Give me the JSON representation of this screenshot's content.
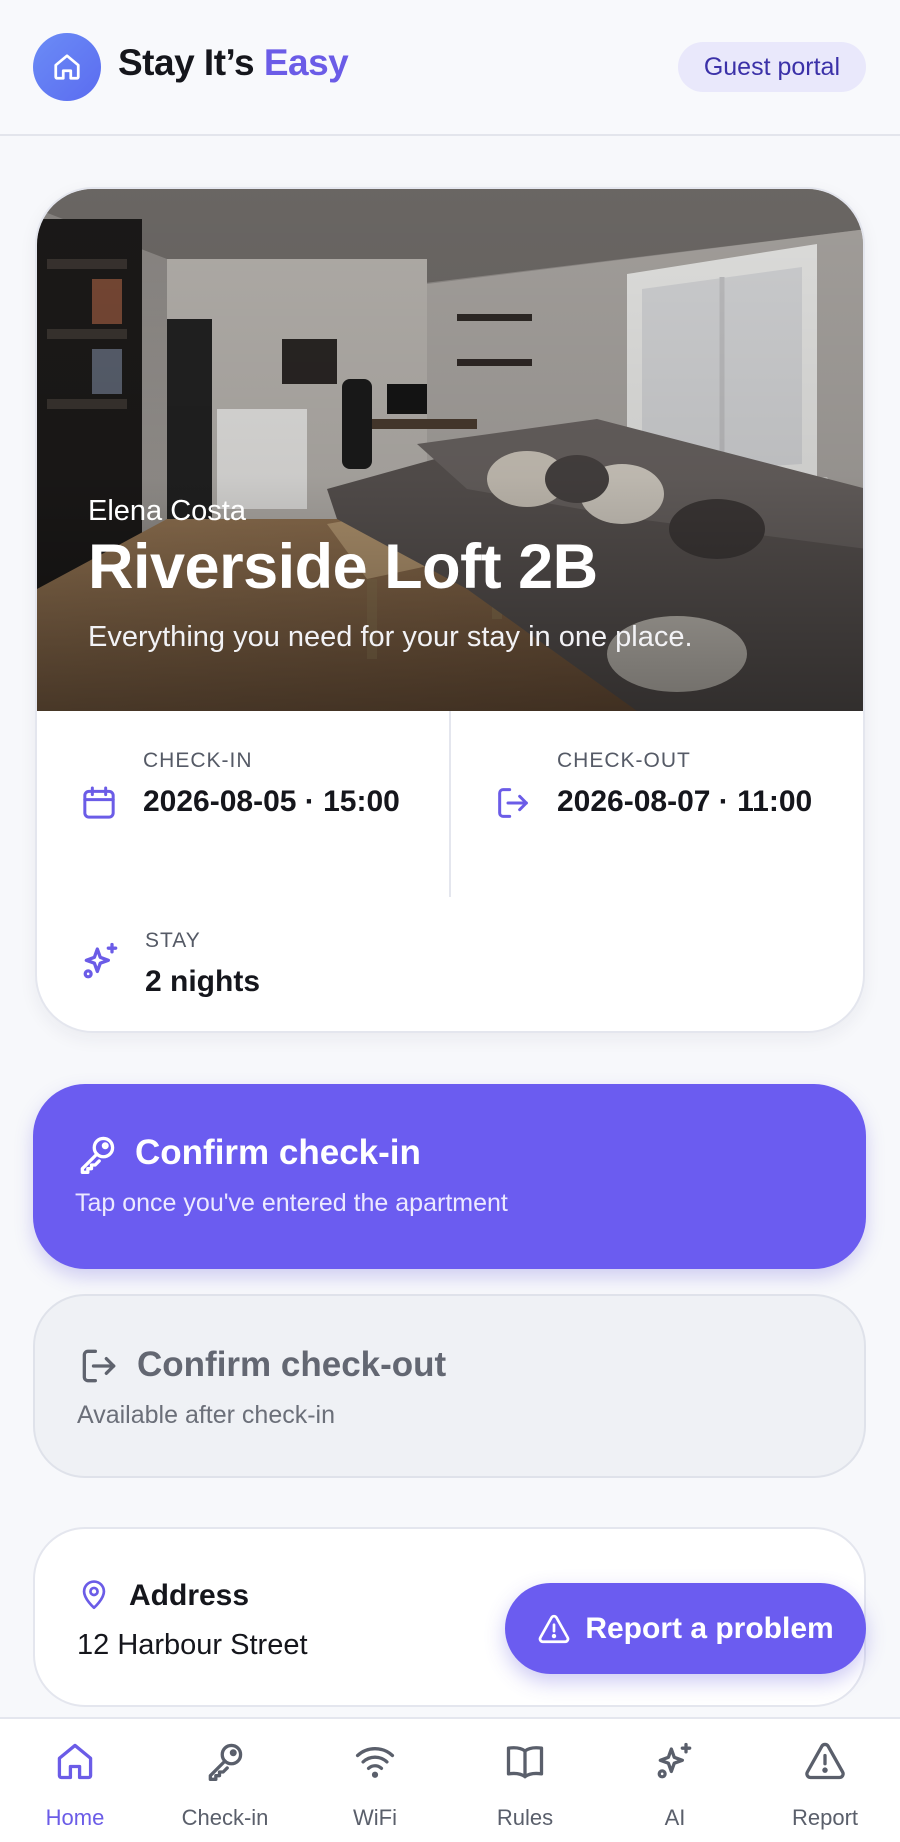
{
  "header": {
    "brand_prefix": "Stay It’s ",
    "brand_accent": "Easy",
    "portal_label": "Guest portal",
    "logo_icon": "home-icon"
  },
  "hero": {
    "guest_name": "Elena Costa",
    "apartment_name": "Riverside Loft 2B",
    "tagline": "Everything you need for your stay in one place.",
    "image": "living-room-photo"
  },
  "stay_info": {
    "checkin_label": "CHECK-IN",
    "checkin_value": "2026-08-05 · 15:00",
    "checkout_label": "CHECK-OUT",
    "checkout_value": "2026-08-07 · 11:00",
    "stay_label": "STAY",
    "stay_value": "2 nights"
  },
  "actions": {
    "checkin_title": "Confirm check-in",
    "checkin_sub": "Tap once you've entered the apartment",
    "checkout_title": "Confirm check-out",
    "checkout_sub": "Available after check-in"
  },
  "address": {
    "title": "Address",
    "value": "12 Harbour Street"
  },
  "report": {
    "label": "Report a problem"
  },
  "nav": {
    "items": [
      {
        "label": "Home",
        "icon": "home-icon",
        "active": true
      },
      {
        "label": "Check-in",
        "icon": "key-icon"
      },
      {
        "label": "WiFi",
        "icon": "wifi-icon"
      },
      {
        "label": "Rules",
        "icon": "book-icon"
      },
      {
        "label": "AI",
        "icon": "sparkles-icon"
      },
      {
        "label": "Report",
        "icon": "warning-icon"
      }
    ]
  },
  "colors": {
    "accent": "#6b5cf0",
    "background": "#f7f8fb",
    "secondary_button": "#eff1f5"
  }
}
